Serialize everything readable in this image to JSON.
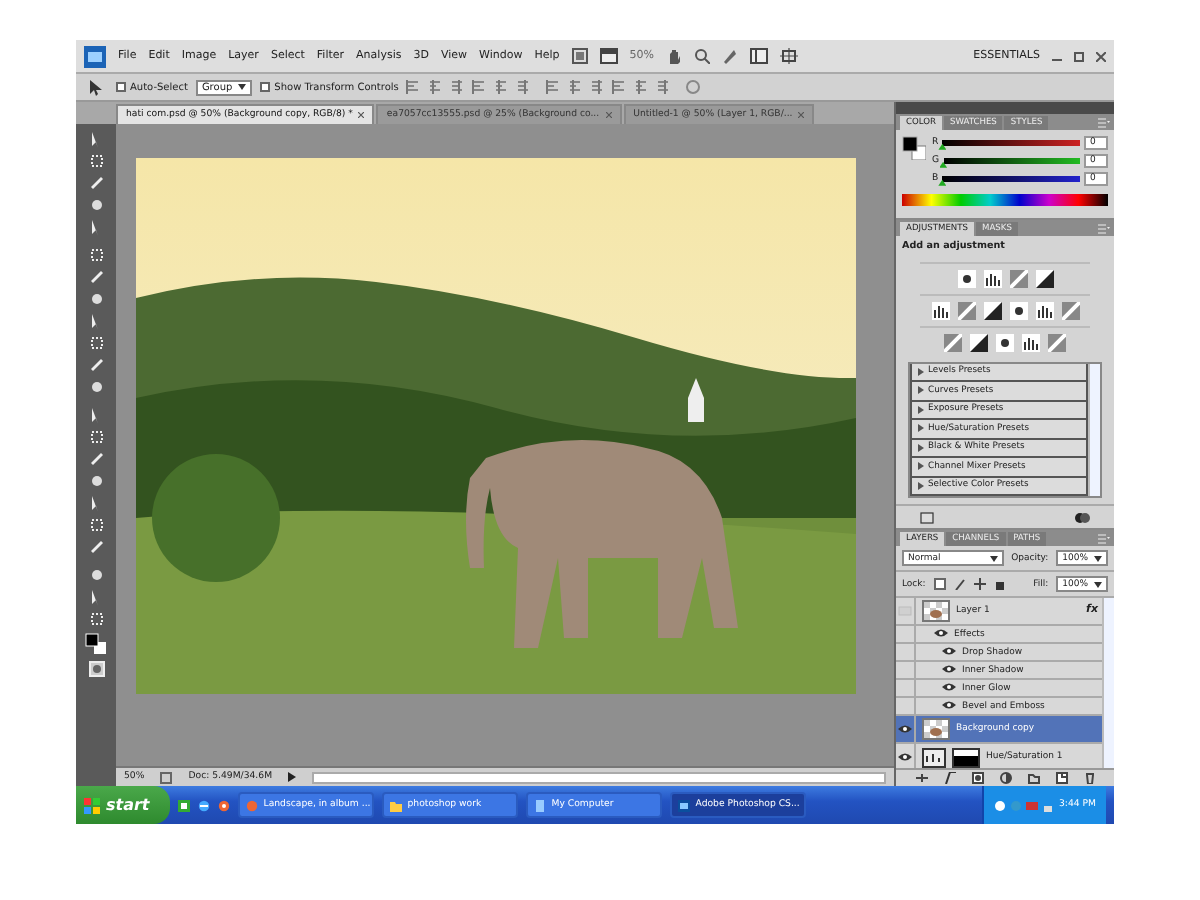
{
  "menu_bar": {
    "items": [
      "File",
      "Edit",
      "Image",
      "Layer",
      "Select",
      "Filter",
      "Analysis",
      "3D",
      "View",
      "Window",
      "Help"
    ],
    "zoom": "50%",
    "workspace": "ESSENTIALS"
  },
  "options_bar": {
    "auto_select": {
      "label": "Auto-Select",
      "checked": false
    },
    "target": "Group",
    "show_transform": {
      "label": "Show Transform Controls",
      "checked": false
    }
  },
  "doc_tabs": [
    {
      "label": "hati com.psd @ 50% (Background copy, RGB/8) *",
      "selected": true
    },
    {
      "label": "ea7057cc13555.psd @ 25% (Background co...",
      "selected": false
    },
    {
      "label": "Untitled-1 @ 50% (Layer 1, RGB/...",
      "selected": false
    }
  ],
  "status_bar": {
    "zoom": "50%",
    "doc_info": "Doc: 5.49M/34.6M"
  },
  "color_panel": {
    "tabs": [
      {
        "label": "COLOR",
        "selected": true
      },
      {
        "label": "SWATCHES",
        "selected": false
      },
      {
        "label": "STYLES",
        "selected": false
      }
    ],
    "channels": [
      {
        "name": "R",
        "value": "0",
        "level": 0
      },
      {
        "name": "G",
        "value": "0",
        "level": 0
      },
      {
        "name": "B",
        "value": "0",
        "level": 0
      }
    ]
  },
  "adjustments_panel": {
    "tabs": [
      {
        "label": "ADJUSTMENTS",
        "selected": true
      },
      {
        "label": "MASKS",
        "selected": false
      }
    ],
    "heading": "Add an adjustment",
    "presets": [
      "Levels Presets",
      "Curves Presets",
      "Exposure Presets",
      "Hue/Saturation Presets",
      "Black & White Presets",
      "Channel Mixer Presets",
      "Selective Color Presets"
    ]
  },
  "layers_panel": {
    "tabs": [
      {
        "label": "LAYERS",
        "selected": true
      },
      {
        "label": "CHANNELS",
        "selected": false
      },
      {
        "label": "PATHS",
        "selected": false
      }
    ],
    "blend_mode": "Normal",
    "opacity_label": "Opacity:",
    "opacity": "100%",
    "lock_label": "Lock:",
    "fill_label": "Fill:",
    "fill": "100%",
    "layers": [
      {
        "name": "Layer 1",
        "kind": "layer",
        "visible": false,
        "selected": false,
        "fx": "fx",
        "effects_label": "Effects",
        "effects": [
          "Drop Shadow",
          "Inner Shadow",
          "Inner Glow",
          "Bevel and Emboss"
        ]
      },
      {
        "name": "Background copy",
        "kind": "layer",
        "visible": true,
        "selected": true
      },
      {
        "name": "Hue/Saturation 1",
        "kind": "adjustment",
        "visible": true,
        "selected": false
      }
    ]
  },
  "taskbar": {
    "start": "start",
    "windows": [
      {
        "label": "Landscape, in album ...",
        "selected": false
      },
      {
        "label": "photoshop work",
        "selected": false
      },
      {
        "label": "My Computer",
        "selected": false
      },
      {
        "label": "Adobe Photoshop CS...",
        "selected": true
      }
    ],
    "clock": "3:44 PM"
  }
}
